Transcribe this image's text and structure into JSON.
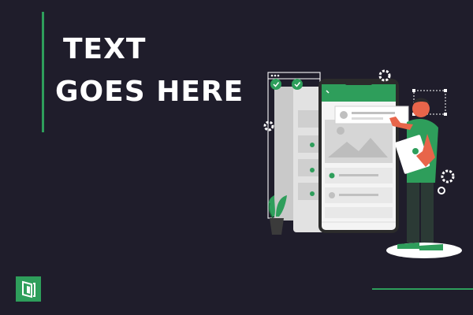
{
  "headline": {
    "line1": "TEXT",
    "line2": "GOES HERE"
  },
  "brand": {
    "accent_color": "#2e9e5b",
    "background_color": "#1f1d2b"
  },
  "logo": {
    "icon": "brand-logo-icon"
  },
  "illustration": {
    "icon": "mobile-app-ui-person-illustration"
  }
}
